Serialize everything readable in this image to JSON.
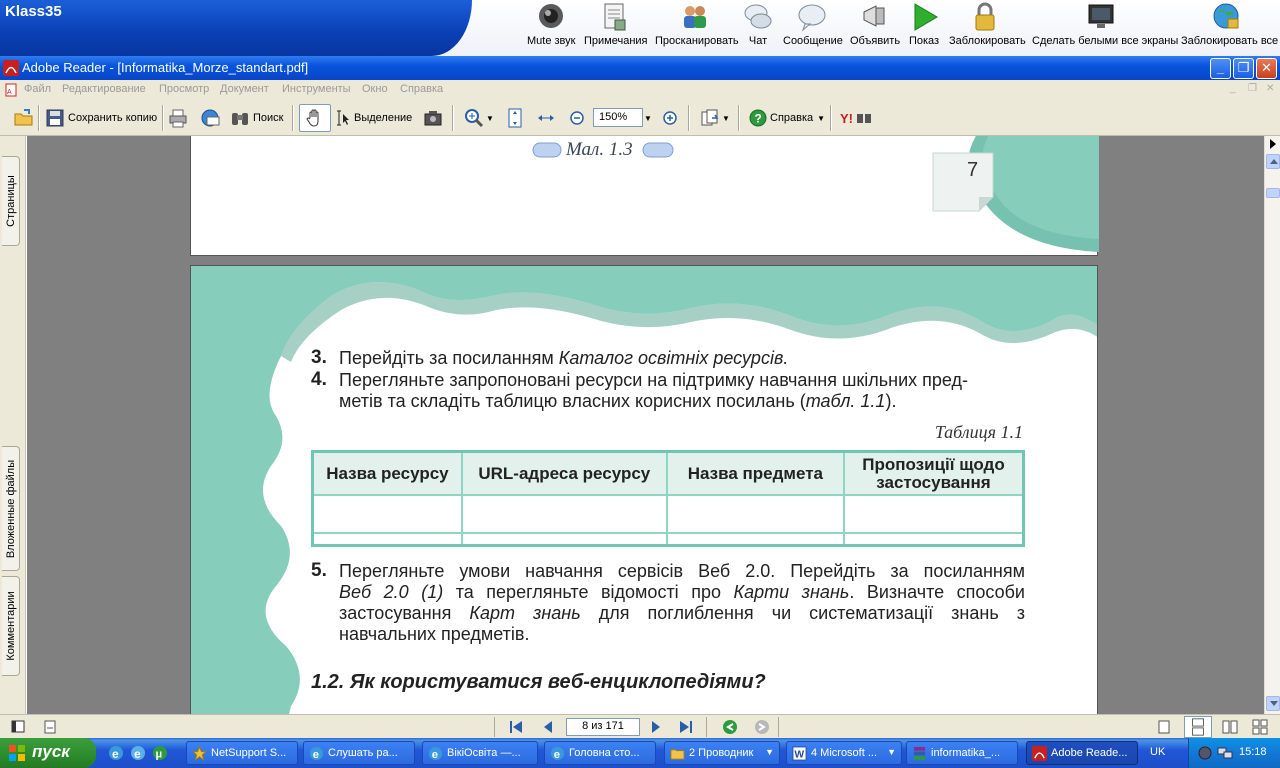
{
  "netsupport": {
    "brand": "Klass35",
    "items": [
      {
        "label": "Mute звук",
        "icon": "speaker-icon"
      },
      {
        "label": "Примечания",
        "icon": "notes-icon"
      },
      {
        "label": "Просканировать",
        "icon": "scan-icon"
      },
      {
        "label": "Чат",
        "icon": "chat-icon"
      },
      {
        "label": "Сообщение",
        "icon": "message-icon"
      },
      {
        "label": "Объявить",
        "icon": "announce-icon"
      },
      {
        "label": "Показ",
        "icon": "show-play-icon"
      },
      {
        "label": "Заблокировать",
        "icon": "lock-icon"
      },
      {
        "label": "Сделать белыми все экраны",
        "icon": "blank-screens-icon"
      },
      {
        "label": "Заблокировать все",
        "icon": "lock-all-globe-icon"
      }
    ]
  },
  "window": {
    "title": "Adobe Reader - [Informatika_Morze_standart.pdf]",
    "minimize": "_",
    "maximize": "❐",
    "close": "✕"
  },
  "menu": [
    "Файл",
    "Редактирование",
    "Просмотр",
    "Документ",
    "Инструменты",
    "Окно",
    "Справка"
  ],
  "toolbar": {
    "save_copy": "Сохранить копию",
    "search": "Поиск",
    "select": "Выделение",
    "zoom": "150%",
    "help": "Справка"
  },
  "side_tabs": {
    "pages": "Страницы",
    "attachments": "Вложенные файлы",
    "comments": "Комментарии"
  },
  "page7": {
    "caption": "Мал. 1.3",
    "page_number": "7"
  },
  "page8": {
    "item3_num": "3.",
    "item3_text": "Перейдіть за посиланням ",
    "item3_link": "Каталог освітніх ресурсів.",
    "item4_num": "4.",
    "item4_line1": "Перегляньте запропоновані ресурси на підтримку навчання шкільних пред-",
    "item4_line2a": "метів та складіть таблицю власних корисних посилань (",
    "item4_line2b": "табл. 1.1",
    "item4_line2c": ").",
    "table_caption": "Таблиця 1.1",
    "table_headers": [
      "Назва ресурсу",
      "URL-адреса ресурсу",
      "Назва предмета",
      "Пропозиції щодо застосування"
    ],
    "item5_num": "5.",
    "item5_p1": "Перегляньте умови навчання сервісів Веб 2.0. Перейдіть за посиланням",
    "item5_p2a": "Веб 2.0 (1)",
    "item5_p2b": " та перегляньте відомості про ",
    "item5_p2c": "Карти знань",
    "item5_p2d": ". Визначте способи",
    "item5_p3a": "застосування ",
    "item5_p3b": "Карт знань",
    "item5_p3c": " для поглиблення чи систематизації знань з",
    "item5_p4": "навчальних предметів.",
    "section_title": "1.2. Як користуватися веб-енциклопедіями?"
  },
  "navigation": {
    "page_indicator": "8 из 171"
  },
  "taskbar": {
    "start": "пуск",
    "tasks": [
      {
        "label": "NetSupport S...",
        "icon": "star-icon"
      },
      {
        "label": "Слушать ра...",
        "icon": "ie-icon"
      },
      {
        "label": "ВікіОсвіта —...",
        "icon": "ie-icon"
      },
      {
        "label": "Головна сто...",
        "icon": "ie-icon"
      },
      {
        "label": "2 Проводник",
        "icon": "folder-icon"
      },
      {
        "label": "4 Microsoft ...",
        "icon": "word-icon"
      },
      {
        "label": "informatika_...",
        "icon": "winrar-icon"
      },
      {
        "label": "Adobe Reade...",
        "icon": "adobe-icon"
      }
    ],
    "language": "UK",
    "clock": "15:18"
  },
  "colors": {
    "teal": "#86cdbb",
    "table_border": "#6fc6b3",
    "xp_blue": "#0855dd",
    "start_green": "#2f8f2f"
  }
}
